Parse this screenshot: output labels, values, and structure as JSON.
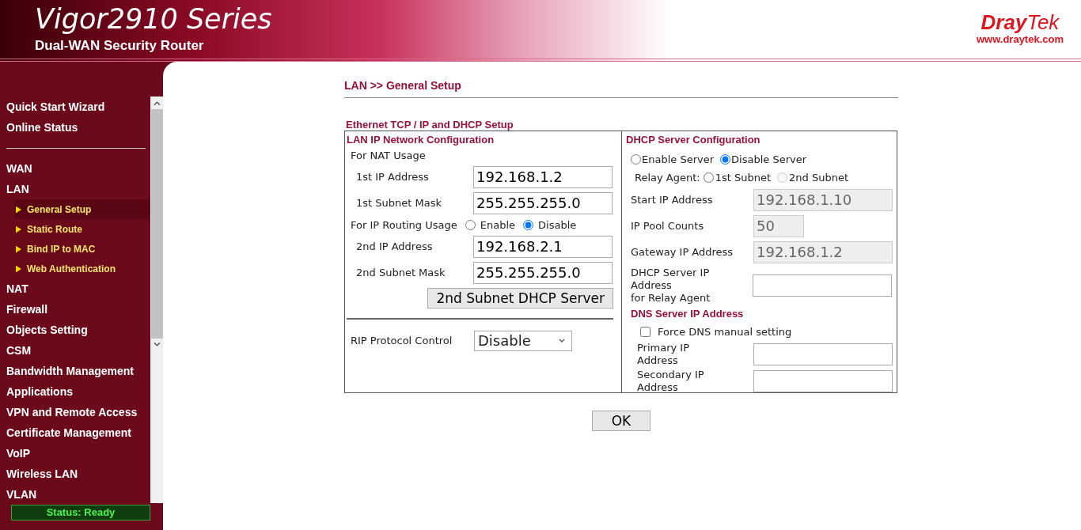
{
  "header": {
    "title": "Vigor2910 Series",
    "subtitle": "Dual-WAN Security Router",
    "logo_parts": [
      "Dray",
      "Tek"
    ],
    "url": "www.draytek.com"
  },
  "sidebar": {
    "groups": [
      [
        {
          "label": "Quick Start Wizard",
          "selected": false
        },
        {
          "label": "Online Status",
          "selected": false
        }
      ],
      [
        {
          "label": "WAN",
          "selected": false
        },
        {
          "label": "LAN",
          "selected": false,
          "children": [
            {
              "label": "General Setup",
              "selected": true
            },
            {
              "label": "Static Route",
              "selected": false
            },
            {
              "label": "Bind IP to MAC",
              "selected": false
            },
            {
              "label": "Web Authentication",
              "selected": false
            }
          ]
        },
        {
          "label": "NAT",
          "selected": false
        },
        {
          "label": "Firewall",
          "selected": false
        },
        {
          "label": "Objects Setting",
          "selected": false
        },
        {
          "label": "CSM",
          "selected": false
        },
        {
          "label": "Bandwidth Management",
          "selected": false
        },
        {
          "label": "Applications",
          "selected": false
        },
        {
          "label": "VPN and Remote Access",
          "selected": false
        },
        {
          "label": "Certificate Management",
          "selected": false
        },
        {
          "label": "VoIP",
          "selected": false
        },
        {
          "label": "Wireless LAN",
          "selected": false
        },
        {
          "label": "VLAN",
          "selected": false
        }
      ]
    ],
    "status": "Status: Ready"
  },
  "breadcrumb": "LAN >> General Setup",
  "section_title": "Ethernet TCP / IP and DHCP Setup",
  "lan": {
    "title": "LAN IP Network Configuration",
    "nat_label": "For NAT Usage",
    "nat_fields": [
      {
        "label": "1st IP Address",
        "value": "192.168.1.2"
      },
      {
        "label": "1st Subnet Mask",
        "value": "255.255.255.0"
      }
    ],
    "routing": {
      "label": "For IP Routing Usage",
      "options": [
        {
          "label": "Enable",
          "selected": false
        },
        {
          "label": "Disable",
          "selected": true
        }
      ]
    },
    "routing_fields": [
      {
        "label": "2nd IP Address",
        "value": "192.168.2.1"
      },
      {
        "label": "2nd Subnet Mask",
        "value": "255.255.255.0"
      }
    ],
    "dhcp_button": "2nd Subnet DHCP Server",
    "rip": {
      "label": "RIP Protocol Control",
      "value": "Disable"
    }
  },
  "dhcp": {
    "title": "DHCP Server Configuration",
    "server_options": [
      {
        "label": "Enable Server",
        "selected": false
      },
      {
        "label": "Disable Server",
        "selected": true
      }
    ],
    "relay": {
      "label": "Relay Agent:",
      "options": [
        {
          "label": "1st Subnet",
          "selected": false,
          "disabled": false
        },
        {
          "label": "2nd Subnet",
          "selected": false,
          "disabled": true
        }
      ]
    },
    "fields": [
      {
        "label": "Start IP Address",
        "value": "192.168.1.10",
        "disabled": true,
        "kind": "address"
      },
      {
        "label": "IP Pool Counts",
        "value": "50",
        "disabled": true,
        "kind": "count"
      },
      {
        "label": "Gateway IP Address",
        "value": "192.168.1.2",
        "disabled": true,
        "kind": "address"
      }
    ],
    "relay_server": {
      "label_lines": [
        "DHCP Server IP Address",
        "for Relay Agent"
      ]
    },
    "dns_title": "DNS Server IP Address",
    "force_dns": {
      "label": "Force DNS manual setting",
      "checked": false
    },
    "dns_fields": [
      {
        "label": "Primary IP Address"
      },
      {
        "label": "Secondary IP Address"
      }
    ]
  },
  "ok_button": "OK"
}
